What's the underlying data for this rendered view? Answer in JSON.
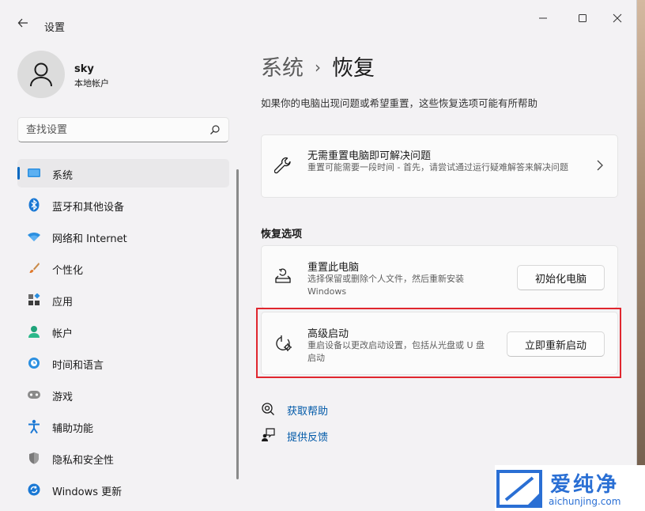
{
  "window": {
    "app_title": "设置",
    "icons": {
      "back": "back-arrow-icon",
      "minimize": "minimize-icon",
      "maximize": "maximize-icon",
      "close": "close-icon"
    }
  },
  "profile": {
    "name": "sky",
    "account_type": "本地帐户",
    "avatar_icon": "person-icon"
  },
  "search": {
    "placeholder": "查找设置",
    "icon": "search-icon"
  },
  "nav": {
    "items": [
      {
        "label": "系统",
        "icon": "system-icon",
        "active": true
      },
      {
        "label": "蓝牙和其他设备",
        "icon": "bluetooth-icon"
      },
      {
        "label": "网络和 Internet",
        "icon": "wifi-icon"
      },
      {
        "label": "个性化",
        "icon": "brush-icon"
      },
      {
        "label": "应用",
        "icon": "apps-icon"
      },
      {
        "label": "帐户",
        "icon": "account-icon"
      },
      {
        "label": "时间和语言",
        "icon": "time-language-icon"
      },
      {
        "label": "游戏",
        "icon": "gaming-icon"
      },
      {
        "label": "辅助功能",
        "icon": "accessibility-icon"
      },
      {
        "label": "隐私和安全性",
        "icon": "shield-icon"
      },
      {
        "label": "Windows 更新",
        "icon": "windows-update-icon"
      }
    ]
  },
  "breadcrumb": {
    "parent": "系统",
    "separator": "›",
    "current": "恢复"
  },
  "subtitle": "如果你的电脑出现问题或希望重置，这些恢复选项可能有所帮助",
  "fix_card": {
    "title": "无需重置电脑即可解决问题",
    "desc": "重置可能需要一段时间 - 首先，请尝试通过运行疑难解答来解决问题",
    "icon": "wrench-icon"
  },
  "recovery_section": {
    "title": "恢复选项",
    "reset": {
      "title": "重置此电脑",
      "desc": "选择保留或删除个人文件，然后重新安装 Windows",
      "button": "初始化电脑",
      "icon": "reset-pc-icon"
    },
    "advanced": {
      "title": "高级启动",
      "desc": "重启设备以更改启动设置，包括从光盘或 U 盘启动",
      "button": "立即重新启动",
      "icon": "advanced-startup-icon"
    }
  },
  "links": {
    "help": {
      "label": "获取帮助",
      "icon": "help-icon"
    },
    "feedback": {
      "label": "提供反馈",
      "icon": "feedback-icon"
    }
  },
  "watermark": {
    "text": "爱纯净",
    "url": "aichunjing.com"
  },
  "colors": {
    "accent": "#0067c0",
    "link": "#0059a8",
    "highlight_box": "#e0262e",
    "watermark": "#2a6fd4"
  }
}
